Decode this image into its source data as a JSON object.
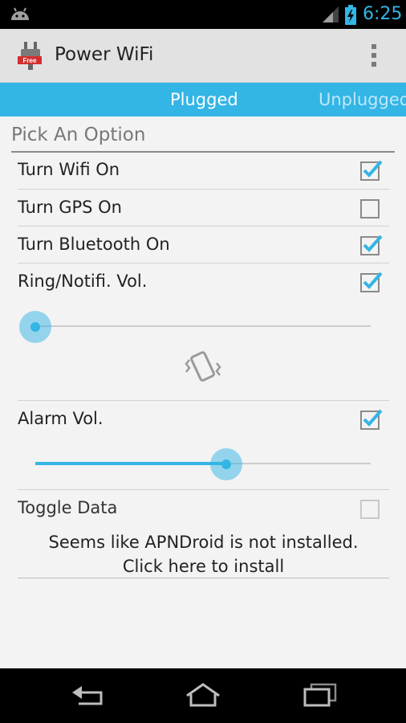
{
  "status_bar": {
    "time": "6:25",
    "icons": [
      "android-notification-icon",
      "signal-icon",
      "battery-charging-icon"
    ],
    "accent_color": "#33b5e5"
  },
  "action_bar": {
    "title": "Power WiFi",
    "app_icon": "plug-free-icon",
    "app_icon_badge": "Free",
    "overflow_icon": "overflow-menu-icon"
  },
  "tabs": [
    {
      "label": "Plugged",
      "selected": true
    },
    {
      "label": "Unplugged",
      "selected": false
    }
  ],
  "section": {
    "header": "Pick An Option",
    "options": [
      {
        "label": "Turn Wifi On",
        "checked": true
      },
      {
        "label": "Turn GPS On",
        "checked": false
      },
      {
        "label": "Turn Bluetooth On",
        "checked": true
      },
      {
        "label": "Ring/Notifi. Vol.",
        "checked": true,
        "slider_level": 0.0,
        "mode_icon": "vibrate-icon"
      },
      {
        "label": "Alarm Vol.",
        "checked": true,
        "slider_level": 0.57
      },
      {
        "label": "Toggle Data",
        "checked": false,
        "enabled": false
      }
    ]
  },
  "notice": {
    "line1": "Seems like APNDroid is not installed.",
    "line2": "Click here to install"
  },
  "nav_bar": {
    "buttons": [
      "back-icon",
      "home-icon",
      "recent-apps-icon"
    ]
  }
}
